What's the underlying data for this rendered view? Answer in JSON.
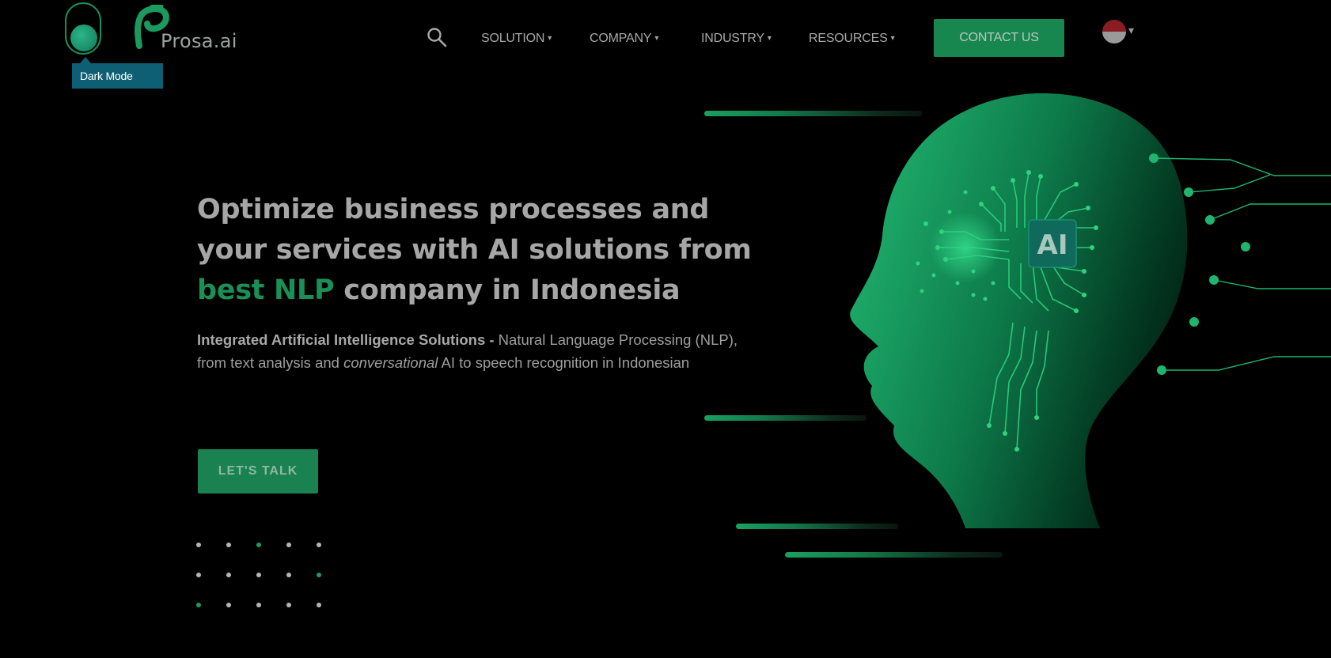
{
  "theme": {
    "accent": "#1a8f56",
    "background": "#000000",
    "tooltip_bg": "#0f5f74",
    "flag_colors": [
      "#8b1c22",
      "#9a9a9a"
    ]
  },
  "header": {
    "dark_mode_tooltip": "Dark Mode",
    "logo_text": "Prosa.ai",
    "nav": [
      {
        "label": "SOLUTION",
        "caret": "▾"
      },
      {
        "label": "COMPANY",
        "caret": "▾"
      },
      {
        "label": "INDUSTRY",
        "caret": "▾"
      },
      {
        "label": "RESOURCES",
        "caret": "▾"
      }
    ],
    "contact_label": "CONTACT US",
    "language_caret": "▾"
  },
  "hero": {
    "headline_1": "Optimize business processes and",
    "headline_2": "your services with AI solutions from",
    "headline_highlight": "best NLP",
    "headline_3": " company in Indonesia",
    "sub_bold": "Integrated Artificial Intelligence Solutions -",
    "sub_1": " Natural Language Processing (NLP), from text analysis and ",
    "sub_italic": "conversational",
    "sub_2": " AI to speech recognition in Indonesian",
    "cta_label": "LET'S TALK"
  },
  "illustration": {
    "chip_label": "AI"
  },
  "icons": [
    "dark-mode-toggle",
    "prosa-logo",
    "search-icon",
    "indonesia-flag-icon",
    "ai-head-illustration"
  ]
}
